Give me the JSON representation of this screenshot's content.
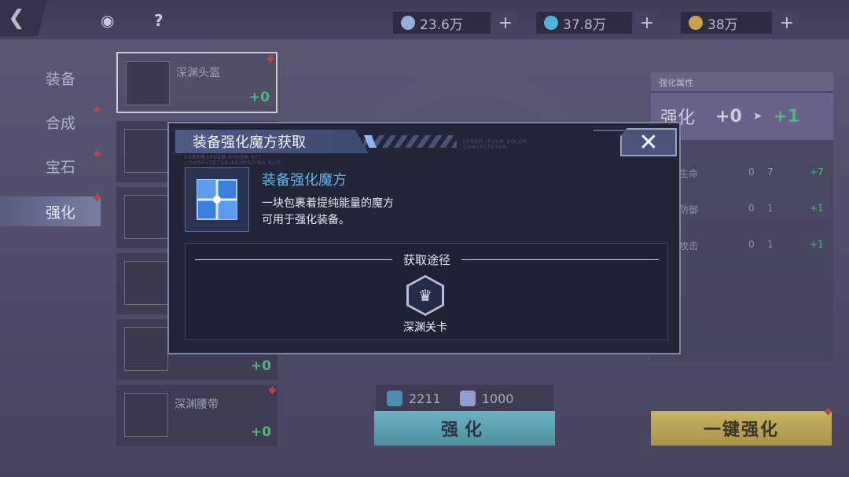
{
  "topbar": {
    "back_icon": "back-arrow-icon",
    "help_label": "?",
    "currencies": [
      {
        "value": "23.6万",
        "icon": "gem-icon",
        "color": "#8fb0e0"
      },
      {
        "value": "37.8万",
        "icon": "crystal-icon",
        "color": "#4fb6d8"
      },
      {
        "value": "38万",
        "icon": "gold-icon",
        "color": "#c9a24a"
      }
    ],
    "plus_label": "+"
  },
  "sidebar": {
    "tabs": [
      {
        "label": "装备"
      },
      {
        "label": "合成"
      },
      {
        "label": "宝石"
      },
      {
        "label": "强化"
      }
    ]
  },
  "equip_list": {
    "items": [
      {
        "name": "深渊头盔",
        "level": "+0"
      },
      {
        "name": "",
        "level": ""
      },
      {
        "name": "",
        "level": ""
      },
      {
        "name": "",
        "level": ""
      },
      {
        "name": "",
        "level": "+0"
      },
      {
        "name": "深渊腰带",
        "level": "+0"
      }
    ]
  },
  "right_panel": {
    "header": "强化属性",
    "main_label": "强化",
    "from_level": "+0",
    "to_level": "+1",
    "stats": [
      {
        "name": "额外生命",
        "from": "0",
        "to": "7",
        "bonus": "+7"
      },
      {
        "name": "额外防御",
        "from": "0",
        "to": "1",
        "bonus": "+1"
      },
      {
        "name": "额外攻击",
        "from": "0",
        "to": "1",
        "bonus": "+1"
      }
    ]
  },
  "bottom": {
    "res1_value": "2211",
    "res2_value": "1000",
    "enhance_label": "强化",
    "onekey_label": "一键强化"
  },
  "dialog": {
    "title": "装备强化魔方获取",
    "lorem_1": "LOREM IPSUM DOLOR SIT",
    "lorem_2": "CONSECTETUR ADIPISCING ELIT",
    "lorem_3": "LOREM IPSUM DOLOR",
    "lorem_4": "CONSECTETUR",
    "close_icon": "close-icon",
    "item_icon": "cube-icon",
    "item_name": "装备强化魔方",
    "item_desc_line1": "一块包裹着提纯能量的魔方",
    "item_desc_line2": "可用于强化装备。",
    "source_header": "获取途径",
    "source_name": "深渊关卡",
    "source_icon": "abyss-stage-icon"
  }
}
